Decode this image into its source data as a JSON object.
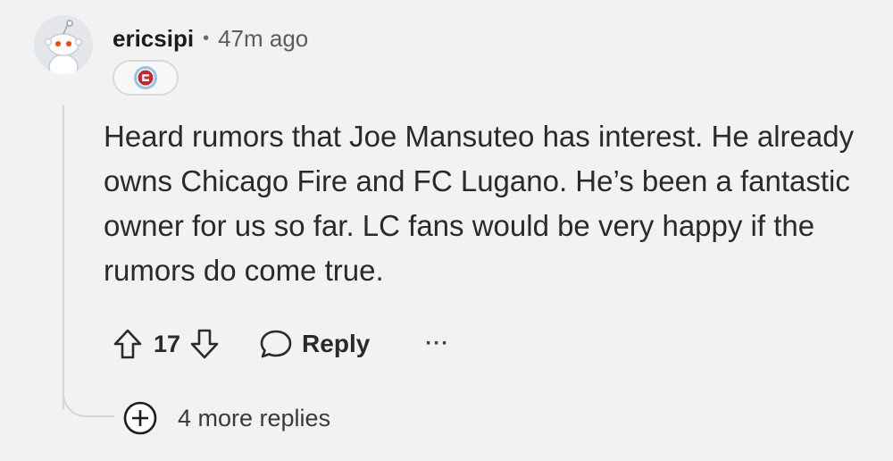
{
  "comment": {
    "username": "ericsipi",
    "separator": "•",
    "timestamp": "47m ago",
    "flair_icon": "chicago-fire-crest-icon",
    "body": "Heard rumors that Joe Mansuteo has interest. He already owns Chicago Fire and FC Lugano. He’s been a fantastic owner for us so far. LC fans would be very happy if the rumors do come true."
  },
  "actions": {
    "upvote_icon": "upvote-arrow-icon",
    "vote_count": "17",
    "downvote_icon": "downvote-arrow-icon",
    "reply_icon": "speech-bubble-icon",
    "reply_label": "Reply",
    "more_label": "···"
  },
  "thread": {
    "more_replies_icon": "plus-circle-icon",
    "more_replies_label": "4 more replies"
  },
  "colors": {
    "background": "#f2f2f2",
    "text": "#1c1c1c",
    "flair_red": "#d2222d",
    "flair_blue": "#8ec5e8"
  }
}
